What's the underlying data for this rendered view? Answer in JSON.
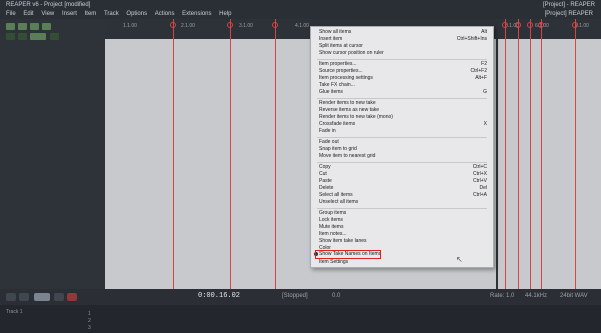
{
  "window": {
    "title": "REAPER v6 - Project [modified]",
    "right_title": "[Project] - REAPER"
  },
  "menubar": {
    "items": [
      "File",
      "Edit",
      "View",
      "Insert",
      "Item",
      "Track",
      "Options",
      "Actions",
      "Extensions",
      "Help"
    ],
    "right": "[Project] REAPER"
  },
  "ruler": {
    "labels": [
      "1.1.00",
      "2.1.00",
      "3.1.00",
      "4.1.00",
      "5.1.00",
      "6.1.00",
      "7.1.00"
    ]
  },
  "transport": {
    "time": "0:00.16.02",
    "status_left": "[Stopped]",
    "status_mid": "0.0",
    "status_right": [
      "Rate: 1.0",
      "44.1kHz",
      "24bit WAV"
    ]
  },
  "bottom": {
    "label": "Track 1",
    "cells": [
      "1",
      "2",
      "3"
    ]
  },
  "context_menu": {
    "items": [
      {
        "label": "Show all items",
        "shortcut": "Alt"
      },
      {
        "label": "Insert item",
        "shortcut": "Ctrl+Shift+Ins"
      },
      {
        "label": "Split items at cursor",
        "shortcut": ""
      },
      {
        "label": "Show cursor position on ruler",
        "shortcut": ""
      },
      {
        "label": "Item properties...",
        "shortcut": "F2"
      },
      {
        "label": "Source properties...",
        "shortcut": "Ctrl+F2"
      },
      {
        "label": "Item processing settings",
        "shortcut": "Alt+F"
      },
      {
        "label": "Take FX chain...",
        "shortcut": ""
      },
      {
        "label": "Glue items",
        "shortcut": "G"
      },
      {
        "label": "Render items to new take",
        "shortcut": ""
      },
      {
        "label": "Reverse items as new take",
        "shortcut": ""
      },
      {
        "label": "Render items to new take (mono)",
        "shortcut": ""
      },
      {
        "label": "Crossfade items",
        "shortcut": "X"
      },
      {
        "label": "Fade in",
        "shortcut": ""
      },
      {
        "label": "Fade out",
        "shortcut": ""
      },
      {
        "label": "Snap item to grid",
        "shortcut": ""
      },
      {
        "label": "Move item to nearest grid",
        "shortcut": ""
      },
      {
        "label": "Copy",
        "shortcut": "Ctrl+C"
      },
      {
        "label": "Cut",
        "shortcut": "Ctrl+X"
      },
      {
        "label": "Paste",
        "shortcut": "Ctrl+V"
      },
      {
        "label": "Delete",
        "shortcut": "Del"
      },
      {
        "label": "Select all items",
        "shortcut": "Ctrl+A"
      },
      {
        "label": "Unselect all items",
        "shortcut": ""
      },
      {
        "label": "Group items",
        "shortcut": ""
      },
      {
        "label": "Lock items",
        "shortcut": ""
      },
      {
        "label": "Mute items",
        "shortcut": ""
      },
      {
        "label": "Item notes...",
        "shortcut": ""
      },
      {
        "label": "Show item take lanes",
        "shortcut": ""
      },
      {
        "label": "Color",
        "shortcut": ""
      },
      {
        "label": "Label",
        "shortcut": ""
      },
      {
        "label": "Show Take Names on Items",
        "shortcut": ""
      },
      {
        "label": "Item Settings",
        "shortcut": ""
      }
    ]
  }
}
